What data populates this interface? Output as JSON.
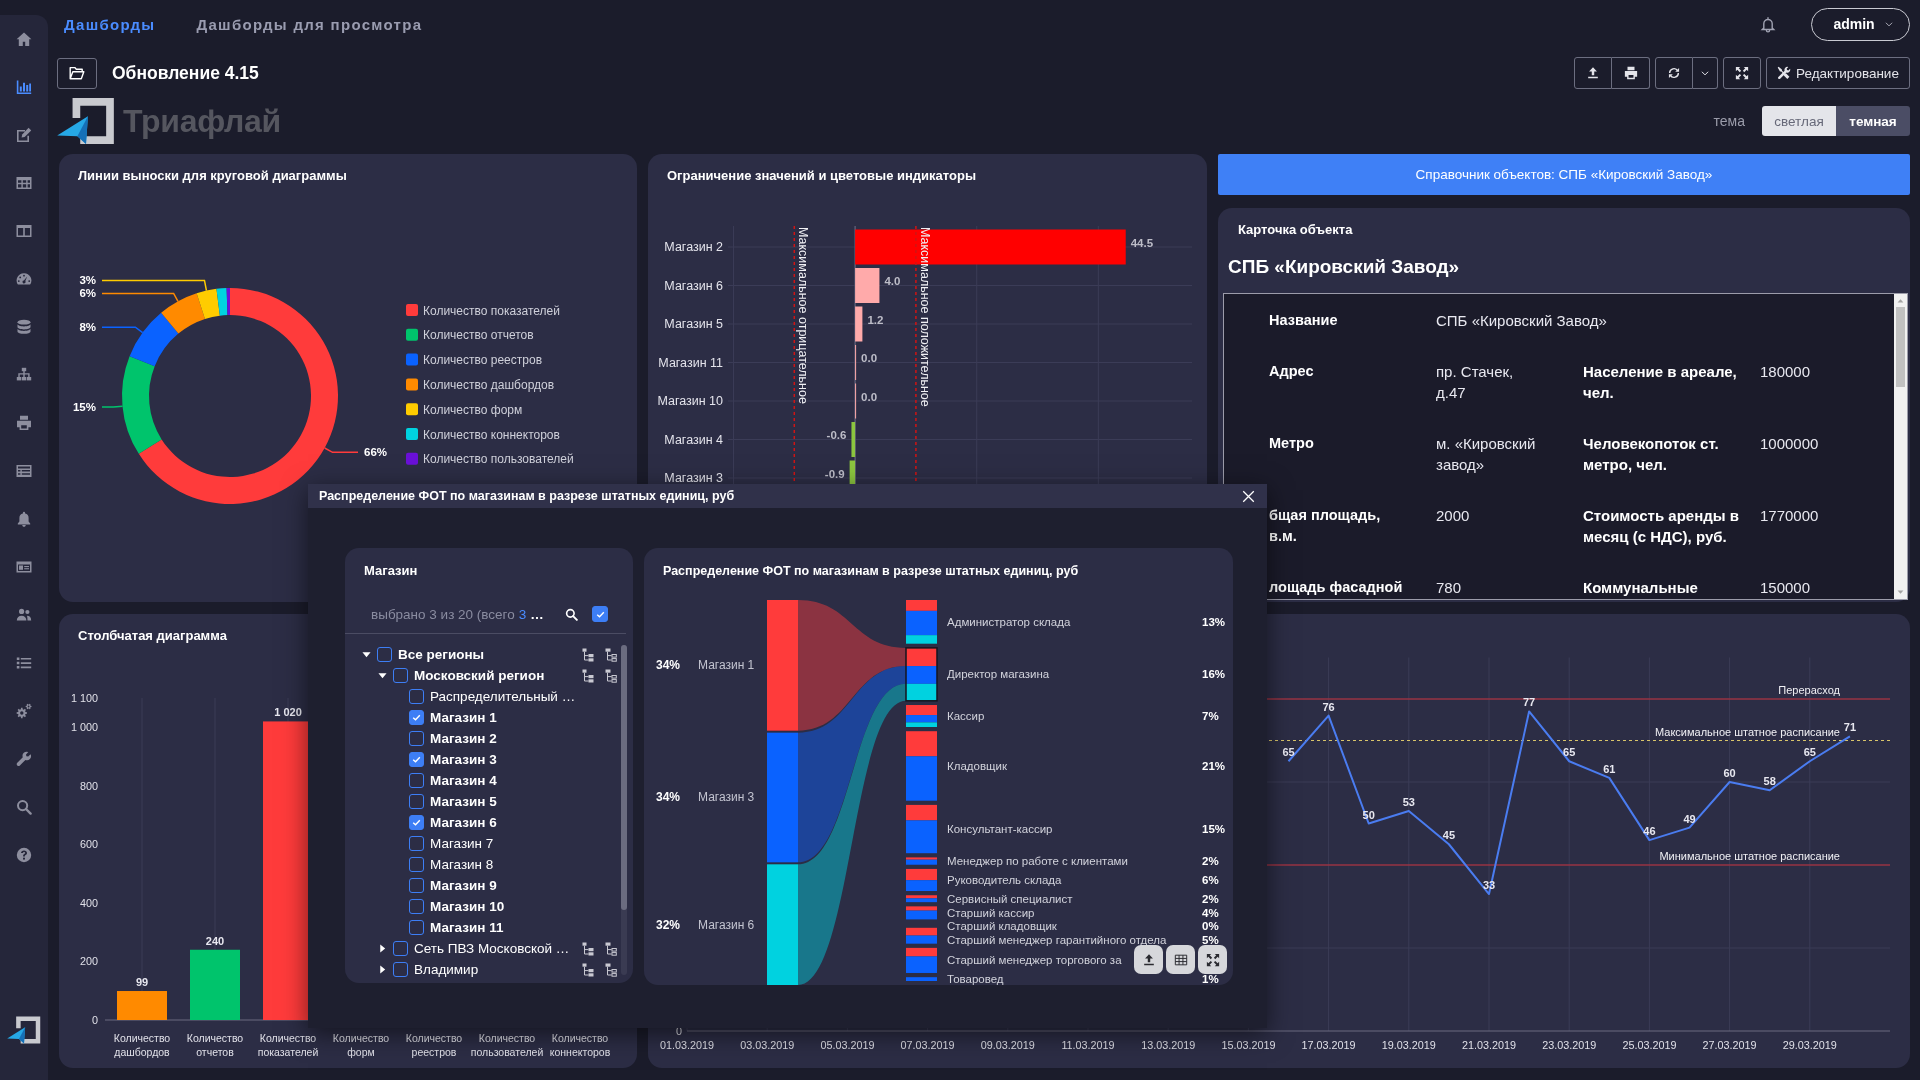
{
  "nav": {
    "tabs": [
      {
        "label": "Дашборды",
        "selected": true
      },
      {
        "label": "Дашборды для просмотра",
        "selected": false
      }
    ]
  },
  "user": {
    "name": "admin"
  },
  "sidebar": {
    "items": [
      {
        "selected": false
      },
      {
        "selected": true
      },
      {
        "selected": false
      },
      {
        "selected": false
      },
      {
        "selected": false
      },
      {
        "selected": false
      },
      {
        "selected": false
      },
      {
        "selected": false
      },
      {
        "selected": false
      },
      {
        "selected": false
      },
      {
        "selected": false
      },
      {
        "selected": false
      },
      {
        "selected": false
      },
      {
        "selected": false
      },
      {
        "selected": false
      },
      {
        "selected": false
      },
      {
        "selected": false
      },
      {
        "selected": false
      }
    ]
  },
  "dashboard": {
    "title": "Обновление 4.15"
  },
  "toolbar": {
    "edit_label": "Редактирование"
  },
  "logo": {
    "text": "Триафлай"
  },
  "theme": {
    "label": "тема",
    "options": [
      {
        "label": "светлая",
        "selected": false
      },
      {
        "label": "темная",
        "selected": true
      }
    ]
  },
  "pie_panel": {
    "title": "Линии выноски для круговой диаграммы",
    "chart_data": {
      "type": "donut",
      "categories": [
        "Количество показателей",
        "Количество отчетов",
        "Количество реестров",
        "Количество дашбордов",
        "Количество форм",
        "Количество коннекторов",
        "Количество пользователей"
      ],
      "values": [
        66,
        15,
        8,
        6,
        3,
        1.5,
        0.5
      ],
      "colors": [
        "#ff3b3b",
        "#00c46c",
        "#0a62ff",
        "#ff8a00",
        "#ffcc00",
        "#00d2e0",
        "#6a10d8"
      ],
      "value_labels": [
        "66%",
        "15%",
        "8%",
        "6%",
        "3%",
        null,
        null
      ],
      "legend": true
    }
  },
  "limits_panel": {
    "title": "Ограничение значений и цветовые индикаторы",
    "chart_data": {
      "type": "bar",
      "orientation": "horizontal",
      "categories": [
        "Магазин 2",
        "Магазин 6",
        "Магазин 5",
        "Магазин 11",
        "Магазин 10",
        "Магазин 4",
        "Магазин 3"
      ],
      "values": [
        44.5,
        4.0,
        1.2,
        0.0,
        0.0,
        -0.6,
        -0.9
      ],
      "value_labels": [
        "44.5",
        "4.0",
        "1.2",
        "0.0",
        "0.0",
        "-0.6",
        "-0.9"
      ],
      "colors": [
        "#ff0000",
        "#ffaaaa",
        "#ffaaaa",
        "#ffaaaa",
        "#ffaaaa",
        "#8cc63f",
        "#8cc63f"
      ],
      "grid": true,
      "ref_lines": [
        {
          "axis": "x",
          "value": -10,
          "label": "Максимальное отрицательное"
        },
        {
          "axis": "x",
          "value": 10,
          "label": "Максимальное положительное"
        }
      ]
    }
  },
  "banner": {
    "text": "Справочник объектов: СПБ «Кировский Завод»"
  },
  "object_card": {
    "title": "Карточка объекта",
    "name": "СПБ «Кировский Завод»",
    "rows": [
      {
        "cells": [
          {
            "label": "Название",
            "value": "СПБ «Кировский Завод»"
          }
        ]
      },
      {
        "cells": [
          {
            "label": "Адрес",
            "value": "пр. Стачек, д.47"
          },
          {
            "label": "Население в ареале, чел.",
            "value": "180000"
          }
        ]
      },
      {
        "cells": [
          {
            "label": "Метро",
            "value": "м. «Кировский завод»"
          },
          {
            "label": "Человекопоток ст. метро, чел.",
            "value": "1000000"
          }
        ]
      },
      {
        "cells": [
          {
            "label": "бщая площадь, в.м.",
            "value": "2000"
          },
          {
            "label": "Стоимость аренды в месяц (с НДС), руб.",
            "value": "1770000"
          }
        ]
      },
      {
        "cells": [
          {
            "label": "лощадь фасадной",
            "value": "780"
          },
          {
            "label": "Коммунальные",
            "value": "150000"
          }
        ]
      }
    ]
  },
  "bar_panel": {
    "title": "Столбчатая диаграмма",
    "chart_data": {
      "type": "bar",
      "categories": [
        "Количество дашбордов",
        "Количество отчетов",
        "Количество показателей",
        "Количество форм",
        "Количество реестров",
        "Количество пользователей",
        "Количество коннекторов"
      ],
      "values": [
        99,
        240,
        1020,
        null,
        null,
        null,
        null
      ],
      "value_labels": [
        "99",
        "240",
        "1 020",
        null,
        null,
        null,
        null
      ],
      "colors": [
        "#ff8a00",
        "#00c46c",
        "#ff3b3b",
        null,
        null,
        null,
        null
      ],
      "ylim": [
        0,
        1100
      ],
      "yticks": [
        {
          "value": 0,
          "label": "0"
        },
        {
          "value": 200,
          "label": "200"
        },
        {
          "value": 400,
          "label": "400"
        },
        {
          "value": 600,
          "label": "600"
        },
        {
          "value": 800,
          "label": "800"
        },
        {
          "value": 1000,
          "label": "1 000"
        },
        {
          "value": 1100,
          "label": "1 100"
        }
      ],
      "grid": true
    }
  },
  "line_panel": {
    "chart_data": {
      "type": "line",
      "categories": [
        "01.03.2019",
        null,
        "03.03.2019",
        null,
        "05.03.2019",
        null,
        "07.03.2019",
        null,
        "09.03.2019",
        null,
        "11.03.2019",
        null,
        "13.03.2019",
        null,
        "15.03.2019",
        null,
        "17.03.2019",
        null,
        "19.03.2019",
        null,
        "21.03.2019",
        null,
        "23.03.2019",
        null,
        "25.03.2019",
        null,
        "27.03.2019",
        null,
        "29.03.2019",
        null
      ],
      "values": [
        null,
        null,
        null,
        null,
        null,
        null,
        null,
        null,
        null,
        null,
        null,
        null,
        null,
        null,
        null,
        65,
        76,
        50,
        53,
        45,
        33,
        77,
        65,
        61,
        46,
        49,
        60,
        58,
        65,
        71
      ],
      "data_labels": true,
      "grid": true,
      "annotations": [
        "0"
      ],
      "ref_lines": [
        {
          "axis": "y",
          "value": 80,
          "label": "Перерасход",
          "color": "#c62f3a"
        },
        {
          "axis": "y",
          "value": 70,
          "label": "Максимальное штатное расписание",
          "color": "#d8c46a"
        },
        {
          "axis": "y",
          "value": 40,
          "label": "Минимальное штатное расписание",
          "color": "#c62f3a"
        }
      ]
    }
  },
  "dialog": {
    "title": "Распределение ФОТ по магазинам в разрезе штатных единиц, руб",
    "filter": {
      "title": "Магазин",
      "summary": "выбрано 3 из 20 (всего",
      "summary_count": "3",
      "summary_more": "…",
      "select_all_checked": true,
      "tree": [
        {
          "kind": "group",
          "label": "Все регионы",
          "checked": false,
          "bold": true,
          "expanded": true,
          "children": [
            {
              "kind": "group",
              "label": "Московский регион",
              "checked": false,
              "bold": true,
              "expanded": true,
              "children": [
                {
                  "kind": "leaf",
                  "label": "Распределительный …",
                  "checked": false,
                  "bold": false
                },
                {
                  "kind": "leaf",
                  "label": "Магазин 1",
                  "checked": true,
                  "bold": true
                },
                {
                  "kind": "leaf",
                  "label": "Магазин 2",
                  "checked": false,
                  "bold": true
                },
                {
                  "kind": "leaf",
                  "label": "Магазин 3",
                  "checked": true,
                  "bold": true
                },
                {
                  "kind": "leaf",
                  "label": "Магазин 4",
                  "checked": false,
                  "bold": true
                },
                {
                  "kind": "leaf",
                  "label": "Магазин 5",
                  "checked": false,
                  "bold": true
                },
                {
                  "kind": "leaf",
                  "label": "Магазин 6",
                  "checked": true,
                  "bold": true
                },
                {
                  "kind": "leaf",
                  "label": "Магазин 7",
                  "checked": false,
                  "bold": false
                },
                {
                  "kind": "leaf",
                  "label": "Магазин 8",
                  "checked": false,
                  "bold": false
                },
                {
                  "kind": "leaf",
                  "label": "Магазин 9",
                  "checked": false,
                  "bold": true
                },
                {
                  "kind": "leaf",
                  "label": "Магазин 10",
                  "checked": false,
                  "bold": true
                },
                {
                  "kind": "leaf",
                  "label": "Магазин 11",
                  "checked": false,
                  "bold": true
                }
              ]
            },
            {
              "kind": "group",
              "label": "Сеть ПВЗ Московской …",
              "checked": false,
              "bold": false,
              "expanded": false
            },
            {
              "kind": "group",
              "label": "Владимир",
              "checked": false,
              "bold": false,
              "expanded": false
            }
          ]
        }
      ]
    },
    "sankey_panel": {
      "title": "Распределение ФОТ по магазинам в разрезе штатных единиц, руб",
      "sources": [
        {
          "label": "Магазин 1",
          "share": "34%",
          "color": "#ff3b3b"
        },
        {
          "label": "Магазин 3",
          "share": "34%",
          "color": "#0a62ff"
        },
        {
          "label": "Магазин 6",
          "share": "32%",
          "color": "#00d2e0"
        }
      ],
      "targets": [
        {
          "label": "Администратор склада",
          "share": "13%",
          "highlighted": false
        },
        {
          "label": "Директор магазина",
          "share": "16%",
          "highlighted": true
        },
        {
          "label": "Кассир",
          "share": "7%",
          "highlighted": false
        },
        {
          "label": "Кладовщик",
          "share": "21%",
          "highlighted": false
        },
        {
          "label": "Консультант-кассир",
          "share": "15%",
          "highlighted": false
        },
        {
          "label": "Менеджер по работе с клиентами",
          "share": "2%",
          "highlighted": false
        },
        {
          "label": "Руководитель склада",
          "share": "6%",
          "highlighted": false
        },
        {
          "label": "Сервисный специалист",
          "share": "2%",
          "highlighted": false
        },
        {
          "label": "Старший кассир",
          "share": "4%",
          "highlighted": false
        },
        {
          "label": "Старший кладовщик",
          "share": "0%"
        },
        {
          "label": "Старший менеджер гарантийного отдела",
          "share": "5%",
          "highlighted": false
        },
        {
          "label": "Старший менеджер торгового за",
          "highlighted": false
        },
        {
          "label": "Товаровед",
          "share": "1%",
          "highlighted": false
        }
      ]
    }
  }
}
